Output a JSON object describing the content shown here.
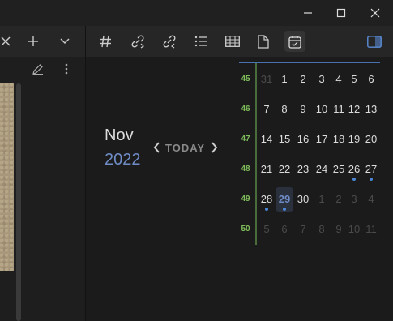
{
  "window_controls": [
    "minimize-icon",
    "maximize-icon",
    "close-icon"
  ],
  "toolbar_icons": [
    "close-tab-icon",
    "new-tab-icon",
    "chevron-down-icon",
    "hash-icon",
    "outgoing-links-icon",
    "backlinks-icon",
    "list-icon",
    "table-icon",
    "file-icon",
    "calendar-icon",
    "sidebar-toggle-icon"
  ],
  "calendar": {
    "month": "Nov",
    "year": "2022",
    "today_label": "TODAY",
    "weeks": [
      {
        "week": "45",
        "days": [
          "31",
          "1",
          "2",
          "3",
          "4",
          "5",
          "6"
        ]
      },
      {
        "week": "46",
        "days": [
          "7",
          "8",
          "9",
          "10",
          "11",
          "12",
          "13"
        ]
      },
      {
        "week": "47",
        "days": [
          "14",
          "15",
          "16",
          "17",
          "18",
          "19",
          "20"
        ]
      },
      {
        "week": "48",
        "days": [
          "21",
          "22",
          "23",
          "24",
          "25",
          "26",
          "27"
        ]
      },
      {
        "week": "49",
        "days": [
          "28",
          "29",
          "30",
          "1",
          "2",
          "3",
          "4"
        ]
      },
      {
        "week": "50",
        "days": [
          "5",
          "6",
          "7",
          "8",
          "9",
          "10",
          "11"
        ]
      }
    ],
    "today_day": "29"
  },
  "colors": {
    "accent": "#6f8cc6",
    "week_number": "#7fbe5a",
    "dot": "#4b86d6"
  }
}
